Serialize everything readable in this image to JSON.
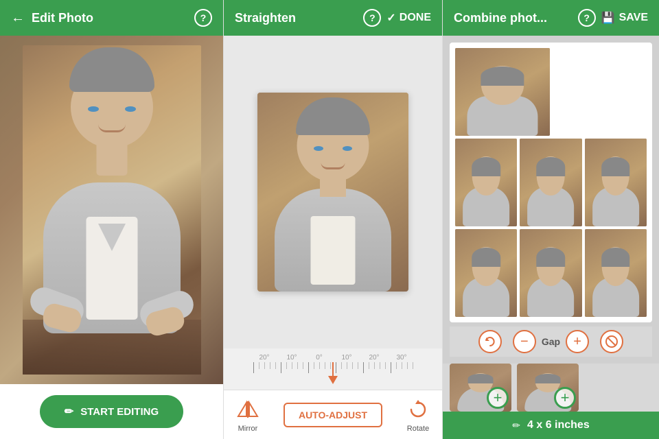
{
  "left": {
    "header": {
      "back_label": "←",
      "title": "Edit Photo",
      "help_label": "?"
    },
    "button": {
      "label": "START EDITING",
      "icon": "✏"
    }
  },
  "middle": {
    "header": {
      "title": "Straighten",
      "help_label": "?",
      "done_label": "DONE",
      "done_check": "✓"
    },
    "ruler": {
      "labels": [
        "20°",
        "10°",
        "0°",
        "10°",
        "20°",
        "30°"
      ]
    },
    "toolbar": {
      "mirror_label": "Mirror",
      "auto_adjust_label": "AUTO-ADJUST",
      "rotate_label": "Rotate"
    }
  },
  "right": {
    "header": {
      "title": "Combine phot...",
      "help_label": "?",
      "save_label": "SAVE",
      "save_icon": "💾"
    },
    "gap_controls": {
      "gap_label": "Gap",
      "minus_label": "−",
      "plus_label": "+"
    },
    "size_bar": {
      "text": "4 x 6 inches",
      "edit_icon": "✏"
    },
    "add_photo_buttons": [
      {
        "type": "photo"
      },
      {
        "type": "add"
      }
    ]
  }
}
